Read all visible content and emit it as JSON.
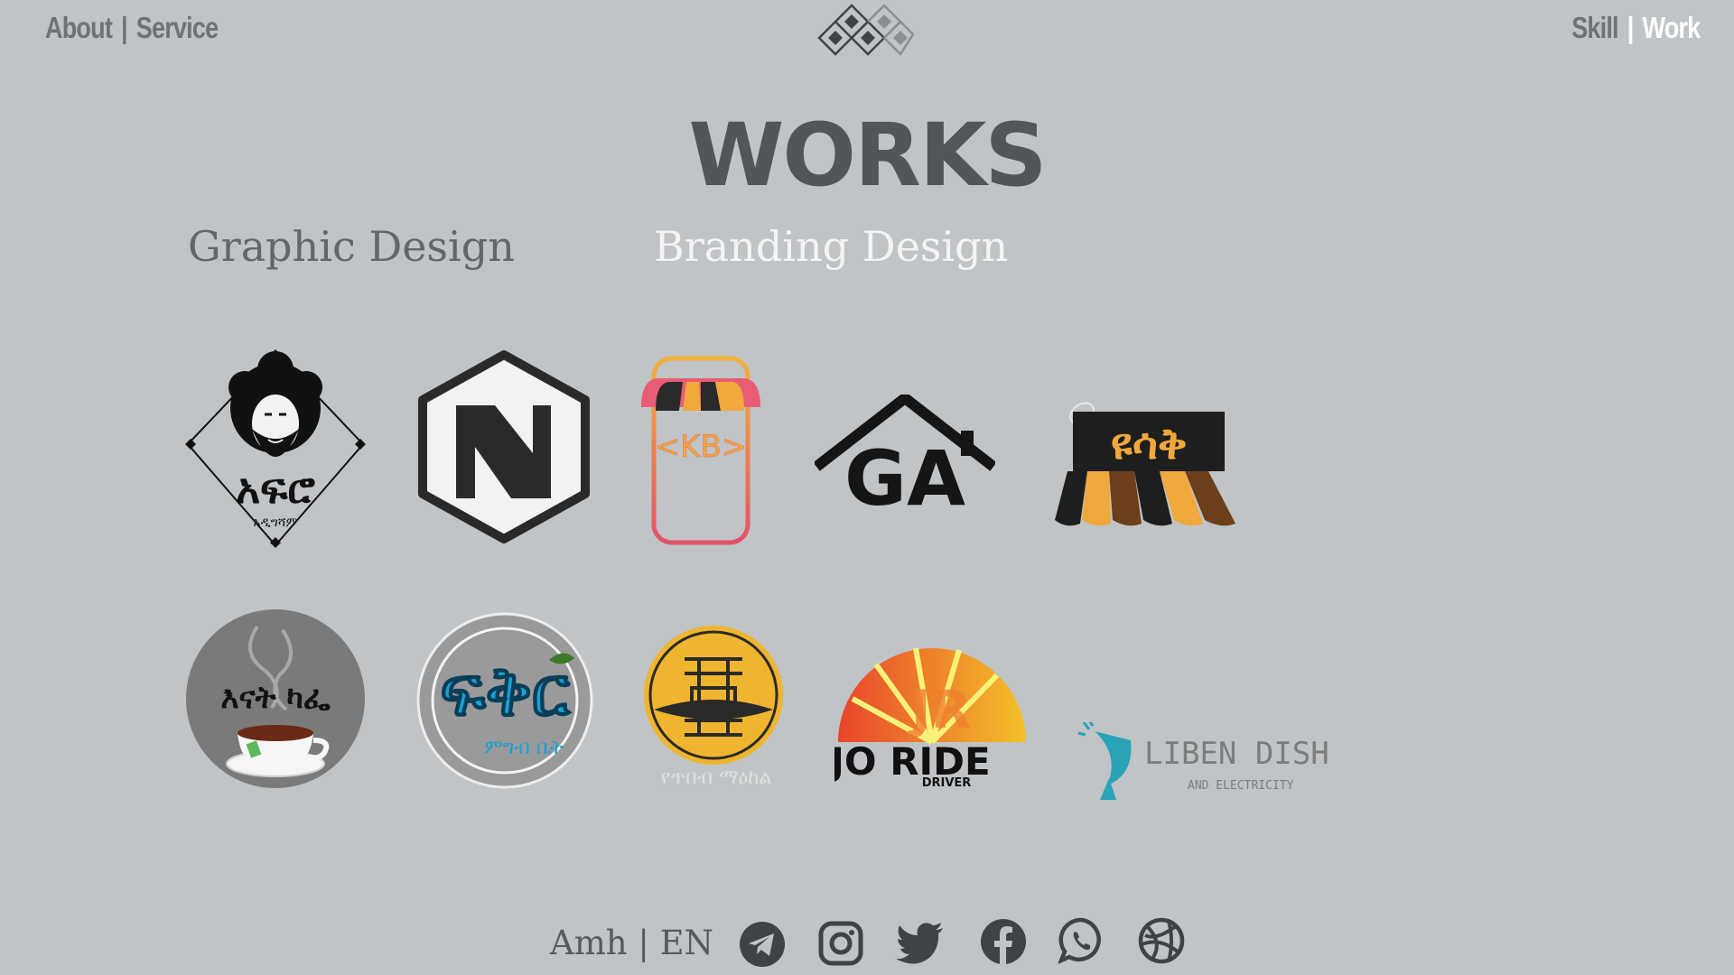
{
  "nav": {
    "about": "About",
    "sep_left": "|",
    "service": "Service",
    "skill": "Skill",
    "sep_right": "|",
    "work": "Work"
  },
  "page": {
    "title": "WORKS"
  },
  "tabs": {
    "graphic": "Graphic Design",
    "branding": "Branding Design"
  },
  "logos": {
    "afro_main": "አፍሮ",
    "afro_sub": "አዲግሻም",
    "kb": "<KB>",
    "ga": "GA",
    "yosak": "ዩሳቅ",
    "enat_cafe": "እናት ካፌ",
    "fikir_main": "ፍቅር",
    "fikir_sub": "ምግብ ቤት",
    "bg_caption": "የጥበብ ማዕከል",
    "jr_mark": "JR",
    "joride_main": "JO RIDE",
    "joride_sub": "DRIVER",
    "liben_main": "LIBEN DISH",
    "liben_sub": "AND ELECTRICITY"
  },
  "footer": {
    "lang_amh": "Amh",
    "lang_sep": "|",
    "lang_en": "EN",
    "social_icons": [
      "telegram-icon",
      "instagram-icon",
      "twitter-icon",
      "facebook-icon",
      "whatsapp-icon",
      "dribbble-icon"
    ]
  },
  "colors": {
    "background": "#c0c4c6",
    "nav_text": "#6f7376",
    "active_text": "#ffffff",
    "title": "#505659",
    "social_icon": "#3d4346",
    "accent_orange": "#f0a83c",
    "accent_blue": "#1aa1d6"
  }
}
